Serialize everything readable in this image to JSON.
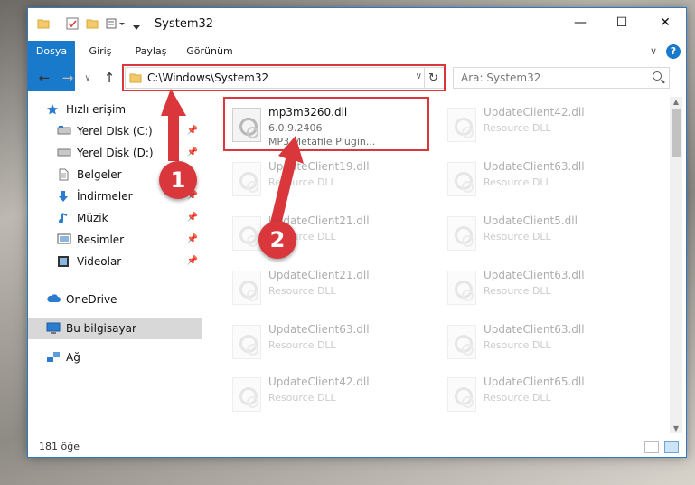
{
  "window": {
    "title": "System32",
    "minimize_glyph": "—",
    "maximize_glyph": "☐",
    "close_glyph": "✕"
  },
  "ribbon": {
    "tabs": [
      "Dosya",
      "Giriş",
      "Paylaş",
      "Görünüm"
    ],
    "collapse_glyph": "∨",
    "help_glyph": "?"
  },
  "nav": {
    "back_glyph": "←",
    "forward_glyph": "→",
    "recent_glyph": "∨",
    "up_glyph": "↑",
    "address_path": "C:\\Windows\\System32",
    "address_dropdown_glyph": "∨",
    "refresh_glyph": "↻",
    "search_placeholder": "Ara: System32"
  },
  "sidebar": {
    "items": [
      {
        "label": "Hızlı erişim",
        "icon": "star-icon",
        "pinned": false
      },
      {
        "label": "Yerel Disk (C:)",
        "icon": "drive-icon",
        "pinned": true
      },
      {
        "label": "Yerel Disk (D:)",
        "icon": "drive-icon",
        "pinned": true
      },
      {
        "label": "Belgeler",
        "icon": "documents-icon",
        "pinned": true
      },
      {
        "label": "İndirmeler",
        "icon": "download-icon",
        "pinned": true
      },
      {
        "label": "Müzik",
        "icon": "music-icon",
        "pinned": true
      },
      {
        "label": "Resimler",
        "icon": "pictures-icon",
        "pinned": true
      },
      {
        "label": "Videolar",
        "icon": "video-icon",
        "pinned": true
      },
      {
        "label": "OneDrive",
        "icon": "cloud-icon",
        "pinned": false
      },
      {
        "label": "Bu bilgisayar",
        "icon": "computer-icon",
        "pinned": false,
        "selected": true
      },
      {
        "label": "Ağ",
        "icon": "network-icon",
        "pinned": false
      }
    ]
  },
  "files": [
    {
      "name": "mp3m3260.dll",
      "line2": "6.0.9.2406",
      "line3": "MP3 Metafile Plugin..."
    },
    {
      "name": "UpdateClient42.dll",
      "line2": "Resource DLL"
    },
    {
      "name": "UpdateClient19.dll",
      "line2": "Resource DLL"
    },
    {
      "name": "UpdateClient63.dll",
      "line2": "Resource DLL"
    },
    {
      "name": "UpdateClient21.dll",
      "line2": "Resource DLL"
    },
    {
      "name": "UpdateClient5.dll",
      "line2": "Resource DLL"
    },
    {
      "name": "UpdateClient21.dll",
      "line2": "Resource DLL"
    },
    {
      "name": "UpdateClient63.dll",
      "line2": "Resource DLL"
    },
    {
      "name": "UpdateClient63.dll",
      "line2": "Resource DLL"
    },
    {
      "name": "UpdateClient63.dll",
      "line2": "Resource DLL"
    },
    {
      "name": "UpdateClient42.dll",
      "line2": "Resource DLL"
    },
    {
      "name": "UpdateClient65.dll",
      "line2": "Resource DLL"
    }
  ],
  "status": {
    "item_count": "181 öğe"
  },
  "callouts": [
    "1",
    "2"
  ],
  "colors": {
    "accent": "#1979ca",
    "highlight": "#d9373c",
    "selected": "#d8d8d8"
  }
}
